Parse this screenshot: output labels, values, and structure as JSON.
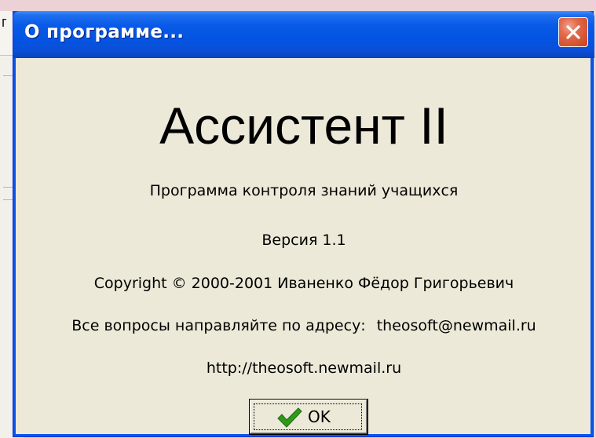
{
  "background_window": {
    "title_fragment": "г"
  },
  "dialog": {
    "title": "О программе...",
    "close_icon": "close-x-icon"
  },
  "about": {
    "app_name": "Ассистент II",
    "description": "Программа контроля знаний учащихся",
    "version": "Версия 1.1",
    "copyright": "Copyright © 2000-2001 Иваненко Фёдор Григорьевич",
    "contact_prefix": "Все вопросы направляйте по адресу:",
    "email": "theosoft@newmail.ru",
    "website": "http://theosoft.newmail.ru"
  },
  "buttons": {
    "ok_label": "OK",
    "ok_icon": "checkmark-icon"
  },
  "colors": {
    "titlebar": "#0454e3",
    "dialog_bg": "#ece9d8",
    "close_button": "#c8411f",
    "checkmark": "#2f9a1a",
    "page_bg": "#ecd2d6"
  }
}
